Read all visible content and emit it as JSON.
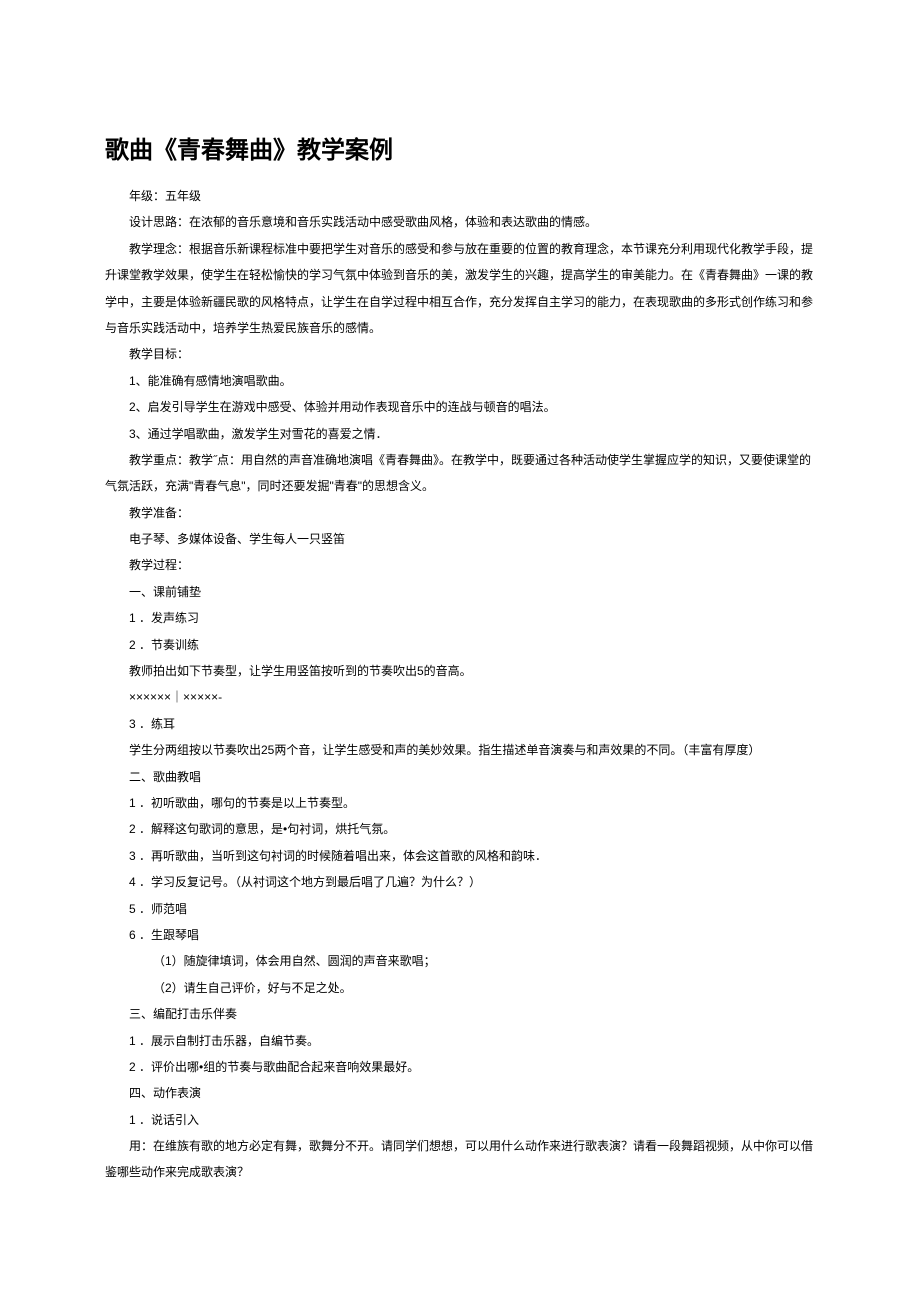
{
  "title": "歌曲《青春舞曲》教学案例",
  "grade": "年级：五年级",
  "design": "设计思路：在浓郁的音乐意境和音乐实践活动中感受歌曲风格，体验和表达歌曲的情感。",
  "concept": "教学理念：根据音乐新课程标准中要把学生对音乐的感受和参与放在重要的位置的教育理念，本节课充分利用现代化教学手段，提升课堂教学效果，使学生在轻松愉快的学习气氛中体验到音乐的美，激发学生的兴趣，提高学生的审美能力。在《青春舞曲》一课的教学中，主要是体验新疆民歌的风格特点，让学生在自学过程中相互合作，充分发挥自主学习的能力，在表现歌曲的多形式创作练习和参与音乐实践活动中，培养学生热爱民族音乐的感情。",
  "goals_label": "教学目标：",
  "goal1": "1、能准确有感情地演唱歌曲。",
  "goal2": "2、启发引导学生在游戏中感受、体验并用动作表现音乐中的连战与顿音的唱法。",
  "goal3": "3、通过学唱歌曲，激发学生对雪花的喜爱之情．",
  "keypoints": "教学重点：教学˝点：用自然的声音准确地演唱《青春舞曲》。在教学中，既要通过各种活动使学生掌握应学的知识，又要使课堂的气氛活跃，充满\"青春气息\"，同时还要发掘\"青春\"的思想含义。",
  "prep_label": "教学准备：",
  "prep_items": "电子琴、多媒体设备、学生每人一只竖笛",
  "process_label": "教学过程：",
  "sec1": "一、课前铺垫",
  "sec1_1": "1 ．发声练习",
  "sec1_2": "2 ．节奏训练",
  "sec1_2_desc": "教师拍出如下节奏型，让学生用竖笛按听到的节奏吹出5的音高。",
  "sec1_2_pattern": "××××××｜×××××-",
  "sec1_3": "3 ．练耳",
  "sec1_3_desc": "学生分两组按以节奏吹出25两个音，让学生感受和声的美妙效果。指生描述单音演奏与和声效果的不同。（丰富有厚度）",
  "sec2": "二、歌曲教唱",
  "sec2_1": "1 ．初听歌曲，哪句的节奏是以上节奏型。",
  "sec2_2": "2 ．解释这句歌词的意思，是•句衬词，烘托气氛。",
  "sec2_3": "3 ．再听歌曲，当听到这句衬词的时候随着唱出来，体会这首歌的风格和韵味．",
  "sec2_4": "4 ．学习反复记号。（从衬词这个地方到最后唱了几遍？为什么？）",
  "sec2_5": "5 ．师范唱",
  "sec2_6": "6 ．生跟琴唱",
  "sec2_6_1": "（1）随旋律填词，体会用自然、圆润的声音来歌唱；",
  "sec2_6_2": "（2）请生自己评价，好与不足之处。",
  "sec3": "三、编配打击乐伴奏",
  "sec3_1": "1 ．展示自制打击乐器，自编节奏。",
  "sec3_2": "2 ．评价出哪•组的节奏与歌曲配合起来音响效果最好。",
  "sec4": "四、动作表演",
  "sec4_1": "1 ．说话引入",
  "sec4_1_desc": "用：在维族有歌的地方必定有舞，歌舞分不开。请同学们想想，可以用什么动作来进行歌表演？请看一段舞蹈视频，从中你可以借鉴哪些动作来完成歌表演？"
}
